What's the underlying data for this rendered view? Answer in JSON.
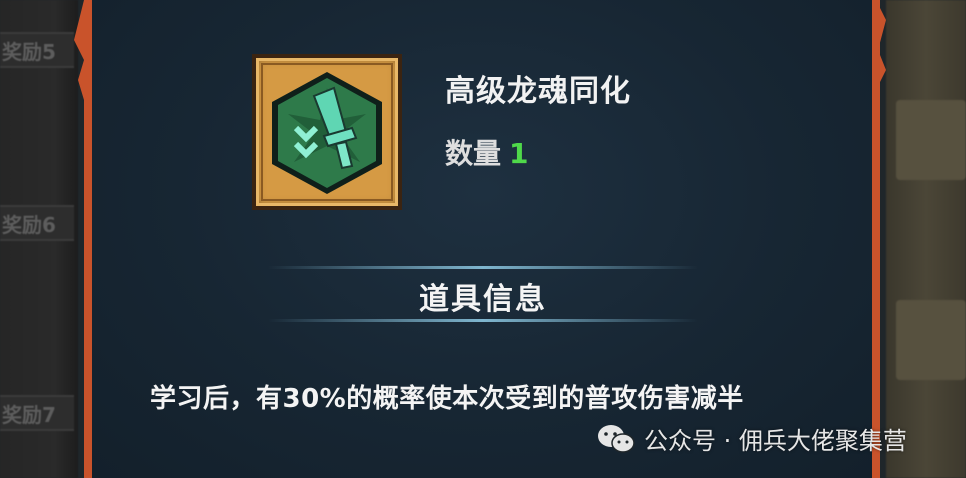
{
  "sidebar": {
    "tabs": [
      {
        "label": "奖励5"
      },
      {
        "label": "奖励6"
      },
      {
        "label": "奖励7"
      }
    ]
  },
  "item": {
    "name": "高级龙魂同化",
    "quantity_label": "数量",
    "quantity_value": "1",
    "icon": "dragon-soul-sword-emblem-icon"
  },
  "info": {
    "title": "道具信息",
    "description": "学习后，有30%的概率使本次受到的普攻伤害减半"
  },
  "watermark": {
    "text": "公众号 · 佣兵大佬聚集营",
    "icon": "wechat-icon"
  },
  "colors": {
    "panel_border": "#c9532b",
    "quantity": "#4fd84a",
    "frame_gold": "#d59a44",
    "emblem_green": "#2e7a4a"
  }
}
